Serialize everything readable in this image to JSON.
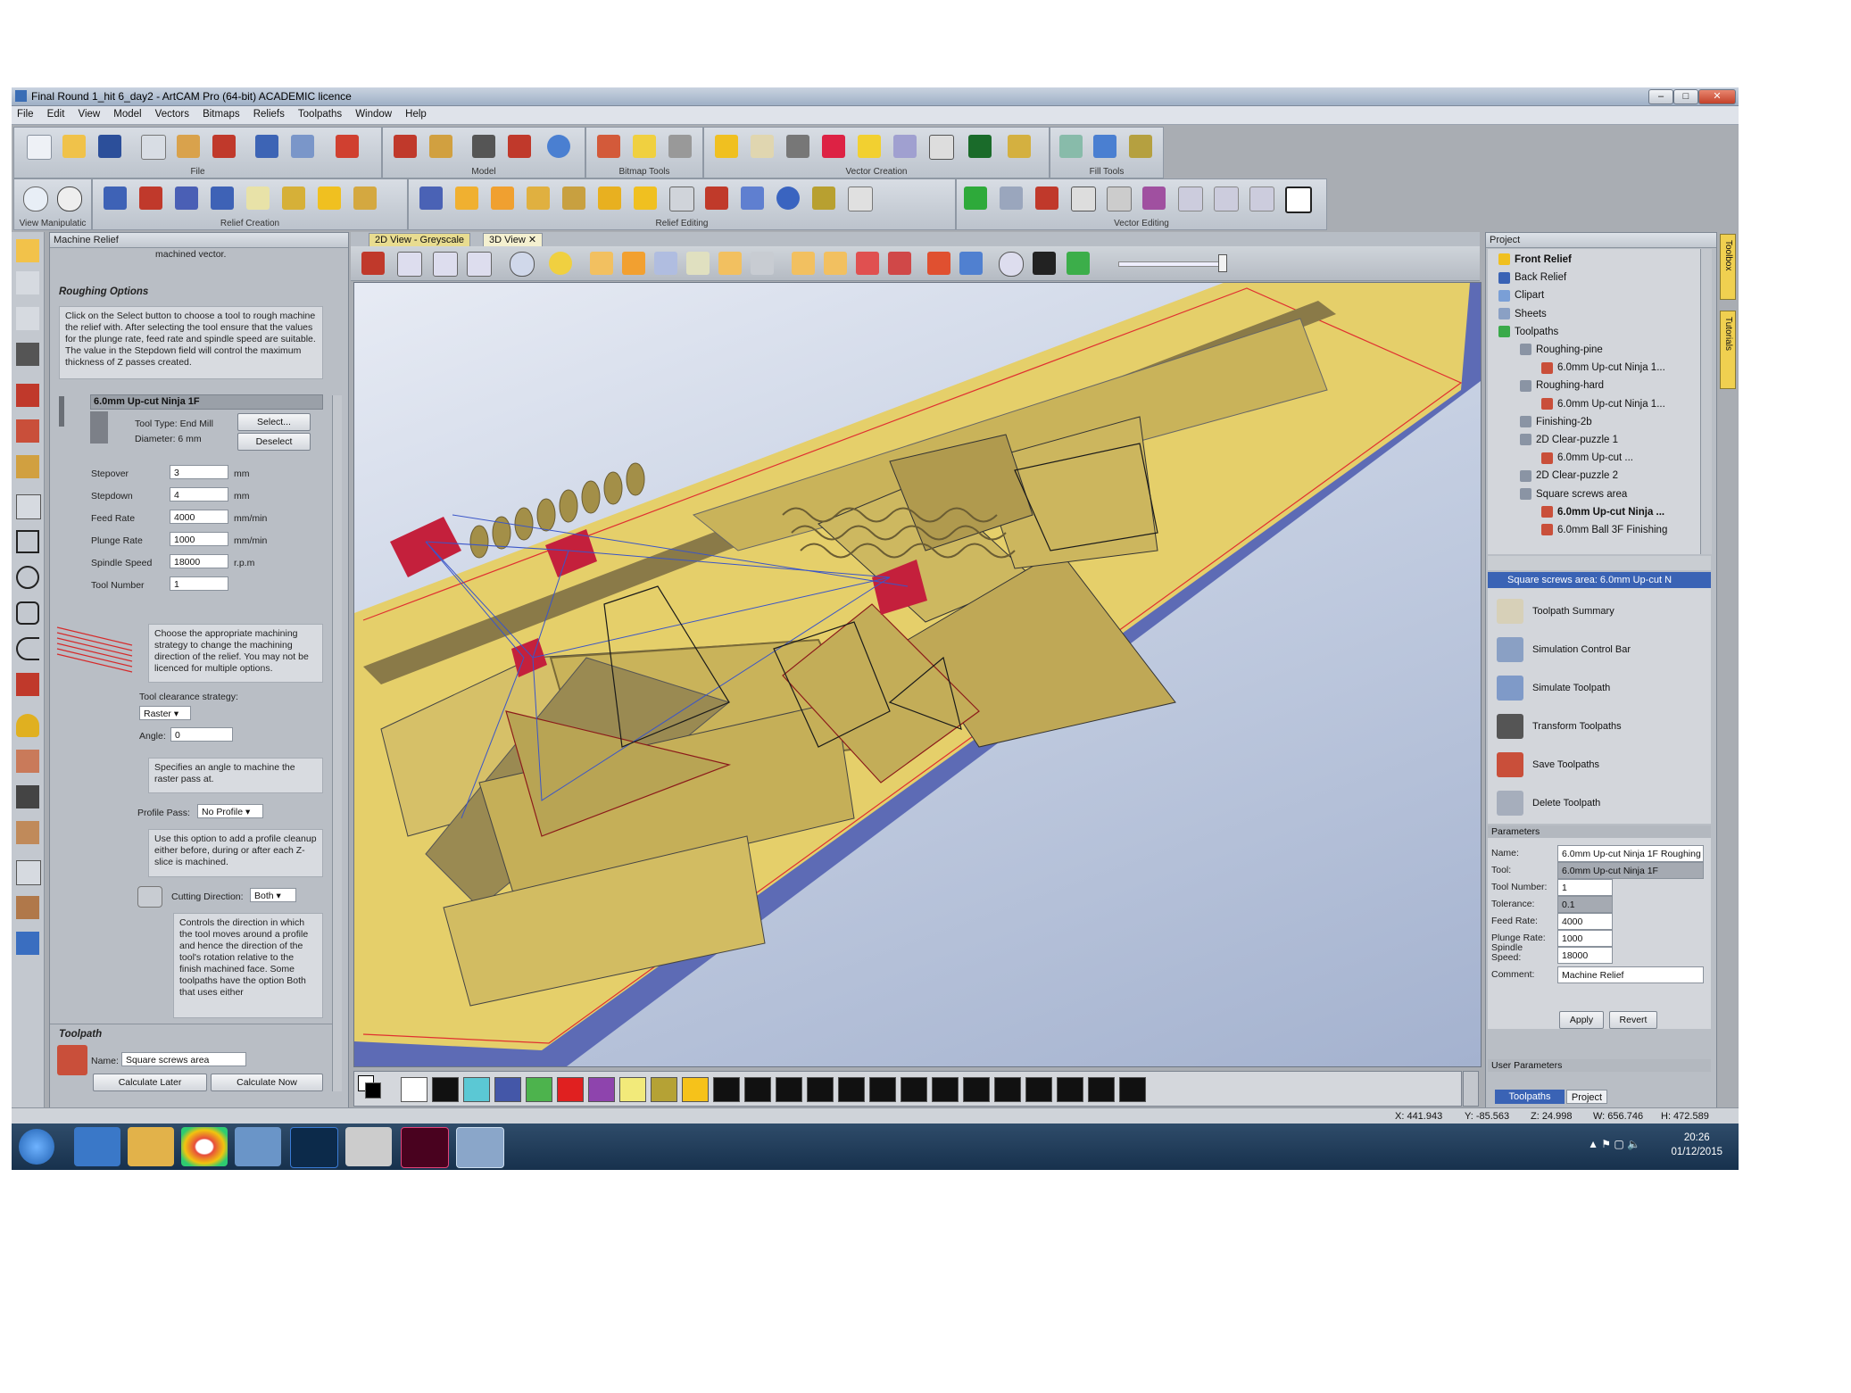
{
  "window": {
    "title": "Final Round 1_hit 6_day2 - ArtCAM Pro (64-bit) ACADEMIC licence"
  },
  "menu": [
    "File",
    "Edit",
    "View",
    "Model",
    "Vectors",
    "Bitmaps",
    "Reliefs",
    "Toolpaths",
    "Window",
    "Help"
  ],
  "toolbar_labels": {
    "file": "File",
    "model": "Model",
    "bitmap": "Bitmap Tools",
    "vector_creation": "Vector Creation",
    "fill": "Fill Tools",
    "view_manip": "View Manipulatic",
    "relief_creation": "Relief Creation",
    "relief_editing": "Relief Editing",
    "vector_editing": "Vector Editing"
  },
  "machine_relief": {
    "header": "Machine Relief",
    "top_text": "machined vector.",
    "roughing_title": "Roughing Options",
    "roughing_info": "Click on the Select button to choose a tool to rough machine the relief with. After selecting the tool ensure that the values for the plunge rate, feed rate and spindle speed are suitable. The value in the Stepdown field will control the maximum thickness of Z passes created.",
    "tool_name": "6.0mm Up-cut Ninja 1F",
    "tool_type": "Tool Type: End Mill",
    "diameter": "Diameter:  6 mm",
    "select_btn": "Select...",
    "deselect_btn": "Deselect",
    "params": [
      {
        "label": "Stepover",
        "value": "3",
        "unit": "mm"
      },
      {
        "label": "Stepdown",
        "value": "4",
        "unit": "mm"
      },
      {
        "label": "Feed Rate",
        "value": "4000",
        "unit": "mm/min"
      },
      {
        "label": "Plunge Rate",
        "value": "1000",
        "unit": "mm/min"
      },
      {
        "label": "Spindle Speed",
        "value": "18000",
        "unit": "r.p.m"
      },
      {
        "label": "Tool Number",
        "value": "1",
        "unit": ""
      }
    ],
    "strategy_info": "Choose the appropriate machining strategy to change the machining direction of the relief. You may not be licenced for multiple options.",
    "clearance_label": "Tool clearance strategy:",
    "clearance_value": "Raster",
    "angle_label": "Angle:",
    "angle_value": "0",
    "angle_info": "Specifies an angle to machine the raster pass at.",
    "profile_label": "Profile Pass:",
    "profile_value": "No Profile",
    "profile_info": "Use this option to add a profile cleanup either before, during or after each Z-slice is machined.",
    "cutting_label": "Cutting Direction:",
    "cutting_value": "Both",
    "cutting_info": "Controls the direction in which the tool moves around a profile and hence the direction of the tool's rotation relative to the finish machined face. Some toolpaths have the option Both that uses either",
    "toolpath_title": "Toolpath",
    "name_label": "Name:",
    "name_value": "Square screws area",
    "calc_later": "Calculate Later",
    "calc_now": "Calculate Now"
  },
  "view": {
    "tabs": [
      "2D View - Greyscale",
      "3D View"
    ],
    "palette": [
      "#ffffff",
      "#111111",
      "#5bc8d4",
      "#4457a8",
      "#4db34d",
      "#e02020",
      "#8e44ad",
      "#f2ea7a",
      "#b5a235",
      "#f6c21a",
      "#111111",
      "#111111",
      "#111111",
      "#111111",
      "#111111",
      "#111111",
      "#111111",
      "#111111",
      "#111111",
      "#111111",
      "#111111",
      "#111111",
      "#111111",
      "#111111"
    ]
  },
  "project": {
    "header": "Project",
    "tree": [
      {
        "label": "Front Relief",
        "level": 0,
        "bold": true
      },
      {
        "label": "Back Relief",
        "level": 0
      },
      {
        "label": "Clipart",
        "level": 0
      },
      {
        "label": "Sheets",
        "level": 0
      },
      {
        "label": "Toolpaths",
        "level": 0
      },
      {
        "label": "Roughing-pine",
        "level": 1
      },
      {
        "label": "6.0mm Up-cut Ninja 1...",
        "level": 2
      },
      {
        "label": "Roughing-hard",
        "level": 1
      },
      {
        "label": "6.0mm Up-cut Ninja 1...",
        "level": 2
      },
      {
        "label": "Finishing-2b",
        "level": 1
      },
      {
        "label": "2D Clear-puzzle 1",
        "level": 1
      },
      {
        "label": "6.0mm Up-cut ...",
        "level": 2
      },
      {
        "label": "2D Clear-puzzle 2",
        "level": 1
      },
      {
        "label": "Square screws area",
        "level": 1
      },
      {
        "label": "6.0mm Up-cut Ninja ...",
        "level": 2,
        "bold": true
      },
      {
        "label": "6.0mm Ball 3F Finishing",
        "level": 2
      }
    ],
    "selection_bar": "Square screws area: 6.0mm Up-cut N",
    "commands": [
      "Toolpath Summary",
      "Simulation Control Bar",
      "Simulate Toolpath",
      "Transform Toolpaths",
      "Save Toolpaths",
      "Delete Toolpath"
    ],
    "params_title": "Parameters",
    "params": [
      {
        "label": "Name:",
        "value": "6.0mm Up-cut Ninja 1F Roughing",
        "gray": false
      },
      {
        "label": "Tool:",
        "value": "6.0mm Up-cut Ninja 1F",
        "gray": true
      },
      {
        "label": "Tool Number:",
        "value": "1",
        "gray": false
      },
      {
        "label": "Tolerance:",
        "value": "0.1",
        "gray": true
      },
      {
        "label": "Feed Rate:",
        "value": "4000",
        "gray": false
      },
      {
        "label": "Plunge Rate:",
        "value": "1000",
        "gray": false
      },
      {
        "label": "Spindle Speed:",
        "value": "18000",
        "gray": false
      },
      {
        "label": "Comment:",
        "value": "Machine Relief",
        "gray": false
      }
    ],
    "apply": "Apply",
    "revert": "Revert",
    "user_params": "User Parameters",
    "bottom_tabs": [
      "Toolpaths",
      "Project"
    ],
    "side_tabs": [
      "Toolbox",
      "Tutorials"
    ]
  },
  "status": {
    "x": "X: 441.943",
    "y": "Y: -85.563",
    "z": "Z: 24.998",
    "w": "W: 656.746",
    "h": "H: 472.589"
  },
  "taskbar": {
    "time": "20:26",
    "date": "01/12/2015"
  }
}
